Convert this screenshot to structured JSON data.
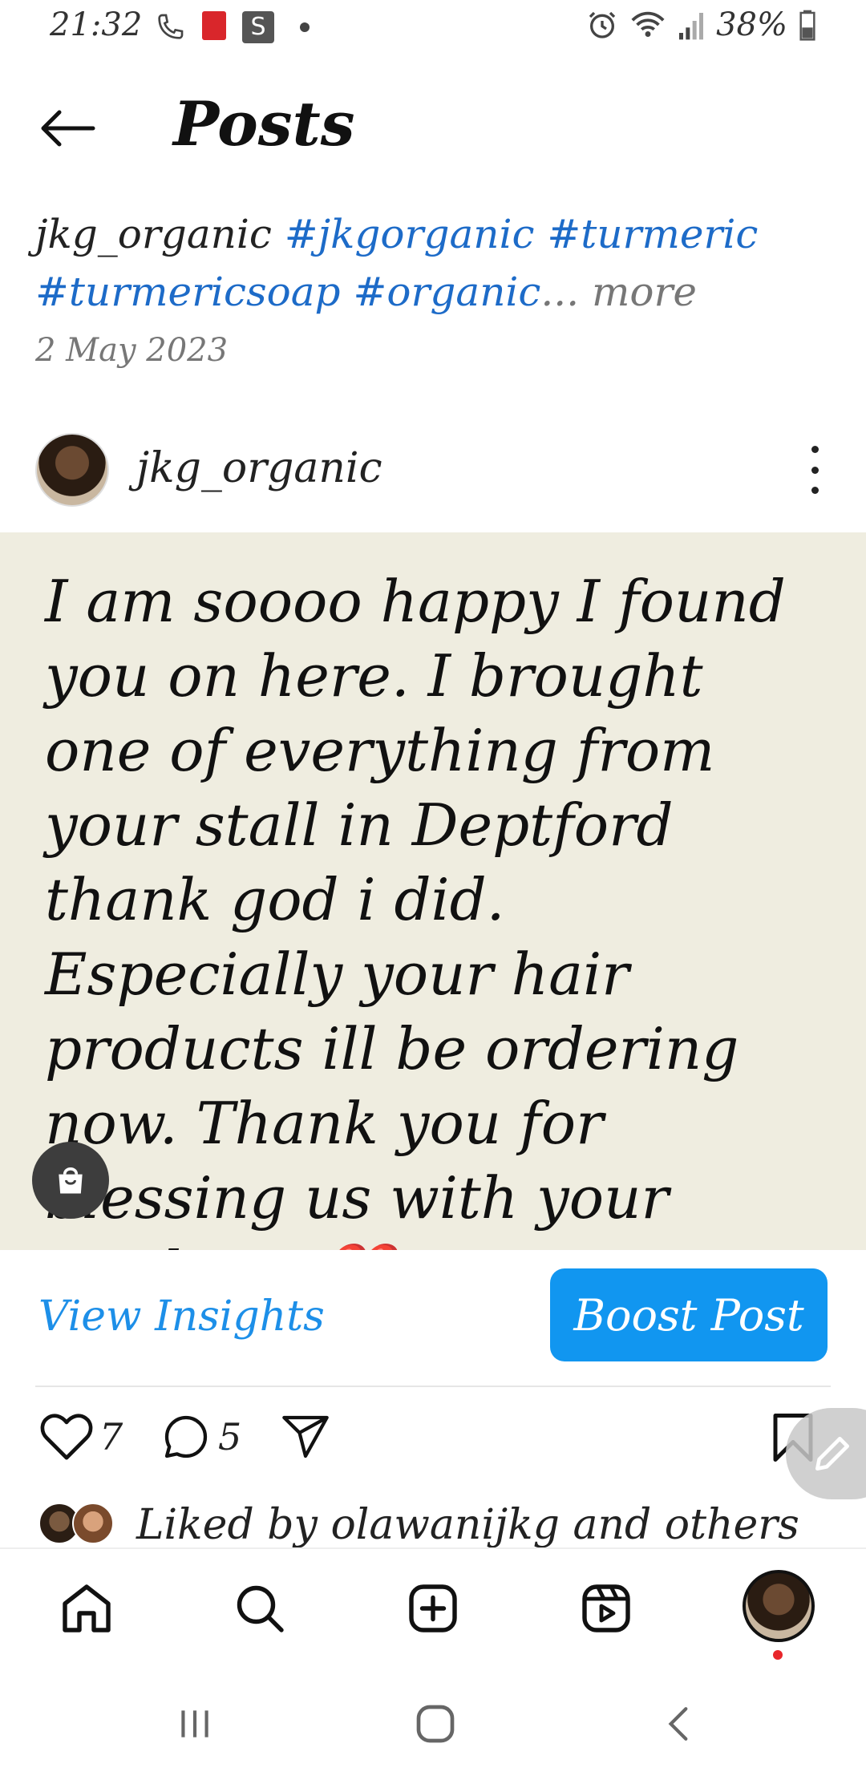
{
  "status_bar": {
    "time": "21:32",
    "battery": "38%",
    "icons": [
      "phone-icon",
      "pdf-icon",
      "s-app-icon",
      "dot-icon",
      "alarm-icon",
      "wifi-icon",
      "signal-icon",
      "battery-icon"
    ]
  },
  "header": {
    "title": "Posts",
    "back_icon": "back-arrow-icon"
  },
  "previous_post": {
    "username": "jkg_organic",
    "hashtags_line1": [
      "#jkgorganic",
      "#turmeric"
    ],
    "hashtags_line2": [
      "#turmericsoap",
      "#organic"
    ],
    "ellipsis": "...",
    "more": "more",
    "date": "2 May 2023"
  },
  "post": {
    "username": "jkg_organic",
    "image_text": "I am soooo happy I found you on here. I brought one of everything from your stall in Deptford thank god i did. Especially your hair products ill be ordering now. Thank you for blessing us with your products",
    "heart_emoji": "❤️",
    "shop_icon": "shopping-bag-icon"
  },
  "insights": {
    "view_insights": "View Insights",
    "boost_post": "Boost Post"
  },
  "actions": {
    "likes_count": "7",
    "comments_count": "5"
  },
  "likes": {
    "text": "Liked by olawanijkg and others"
  },
  "bottom_nav": [
    "home-icon",
    "search-icon",
    "create-icon",
    "reels-icon",
    "profile-avatar"
  ],
  "colors": {
    "accent_blue": "#1196f0",
    "link_blue": "#1d8fe8",
    "hashtag_blue": "#1d6bc8",
    "image_bg": "#efede0",
    "notification_red": "#e8262b"
  }
}
